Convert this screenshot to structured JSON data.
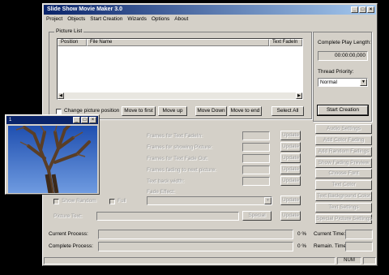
{
  "window": {
    "title": "Slide Show Movie Maker 3.0"
  },
  "menu": [
    "Project",
    "Objects",
    "Start Creation",
    "Wizards",
    "Options",
    "About"
  ],
  "picture_list": {
    "label": "Picture List",
    "columns": [
      "Position",
      "File Name",
      "Text FadeIn"
    ],
    "change_position_label": "Change picture position",
    "buttons": {
      "move_first": "Move to first",
      "move_up": "Move up",
      "move_down": "Move Down",
      "move_end": "Move to end",
      "select_all": "Select All"
    }
  },
  "right_panel": {
    "complete_length_label": "Complete Play Length:",
    "complete_length_value": "00:00:00,000",
    "thread_priority_label": "Thread Priority:",
    "thread_priority_value": "Normal",
    "start_creation": "Start Creation"
  },
  "settings": {
    "fields": [
      {
        "label": "Frames for Text FadeIn:",
        "button": "Update"
      },
      {
        "label": "Frames for showing Picture:",
        "button": "Update"
      },
      {
        "label": "Frames for Text Fade Out:",
        "button": "Update"
      },
      {
        "label": "Frames fading to next picture:",
        "button": "Update"
      },
      {
        "label": "Text back width:",
        "button": "Update"
      }
    ],
    "fade_effect_label": "Fade Effect:",
    "fade_effect_button": "Update",
    "show_random_label": "Show Random",
    "full_label": "Full",
    "picture_text_label": "Picture Text:",
    "special_button": "Special",
    "picture_text_update": "Update"
  },
  "side_buttons": [
    "Audio Settings",
    "Add Color Fading",
    "Add Random Fadings",
    "Show Fading Preview",
    "Choose Font",
    "Text Color",
    "Text Background Color",
    "Text Settings",
    "Special Picture Settings"
  ],
  "progress": {
    "current_label": "Current Process:",
    "complete_label": "Complete Process:",
    "current_pct": "0 %",
    "complete_pct": "0 %",
    "current_time_label": "Current Time:",
    "remain_time_label": "Remain. Time:"
  },
  "status": {
    "num": "NUM"
  },
  "preview": {
    "title": "1"
  }
}
